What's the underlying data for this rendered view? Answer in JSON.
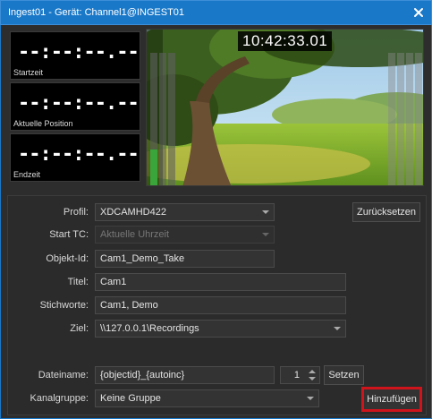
{
  "window": {
    "title": "Ingest01 - Gerät: Channel1@INGEST01",
    "close_icon": "close-icon"
  },
  "timecodes": [
    {
      "value": "--:--:--.--",
      "label": "Startzeit"
    },
    {
      "value": "--:--:--.--",
      "label": "Aktuelle Position"
    },
    {
      "value": "--:--:--.--",
      "label": "Endzeit"
    }
  ],
  "preview": {
    "clock": "10:42:33.01"
  },
  "audio_meters": {
    "left_levels": [
      0.22,
      0.0,
      0.0
    ],
    "right_levels": [
      0.0,
      0.0,
      0.0,
      0.0
    ],
    "colors": {
      "green": "#3aa53a",
      "yellow": "#c8b400",
      "red": "#d02020"
    }
  },
  "form": {
    "profil": {
      "label": "Profil:",
      "value": "XDCAMHD422"
    },
    "reset_button": "Zurücksetzen",
    "start_tc": {
      "label": "Start TC:",
      "value": "Aktuelle Uhrzeit"
    },
    "objekt_id": {
      "label": "Objekt-Id:",
      "value": "Cam1_Demo_Take"
    },
    "titel": {
      "label": "Titel:",
      "value": "Cam1"
    },
    "stichworte": {
      "label": "Stichworte:",
      "value": "Cam1, Demo"
    },
    "ziel": {
      "label": "Ziel:",
      "value": "\\\\127.0.0.1\\Recordings"
    },
    "dateiname": {
      "label": "Dateiname:",
      "value": "{objectid}_{autoinc}",
      "counter": "1"
    },
    "set_button": "Setzen",
    "kanalgruppe": {
      "label": "Kanalgruppe:",
      "value": "Keine Gruppe"
    },
    "add_button": "Hinzufügen"
  },
  "colors": {
    "titlebar": "#1a78c8",
    "highlight_border": "#d0141c"
  }
}
